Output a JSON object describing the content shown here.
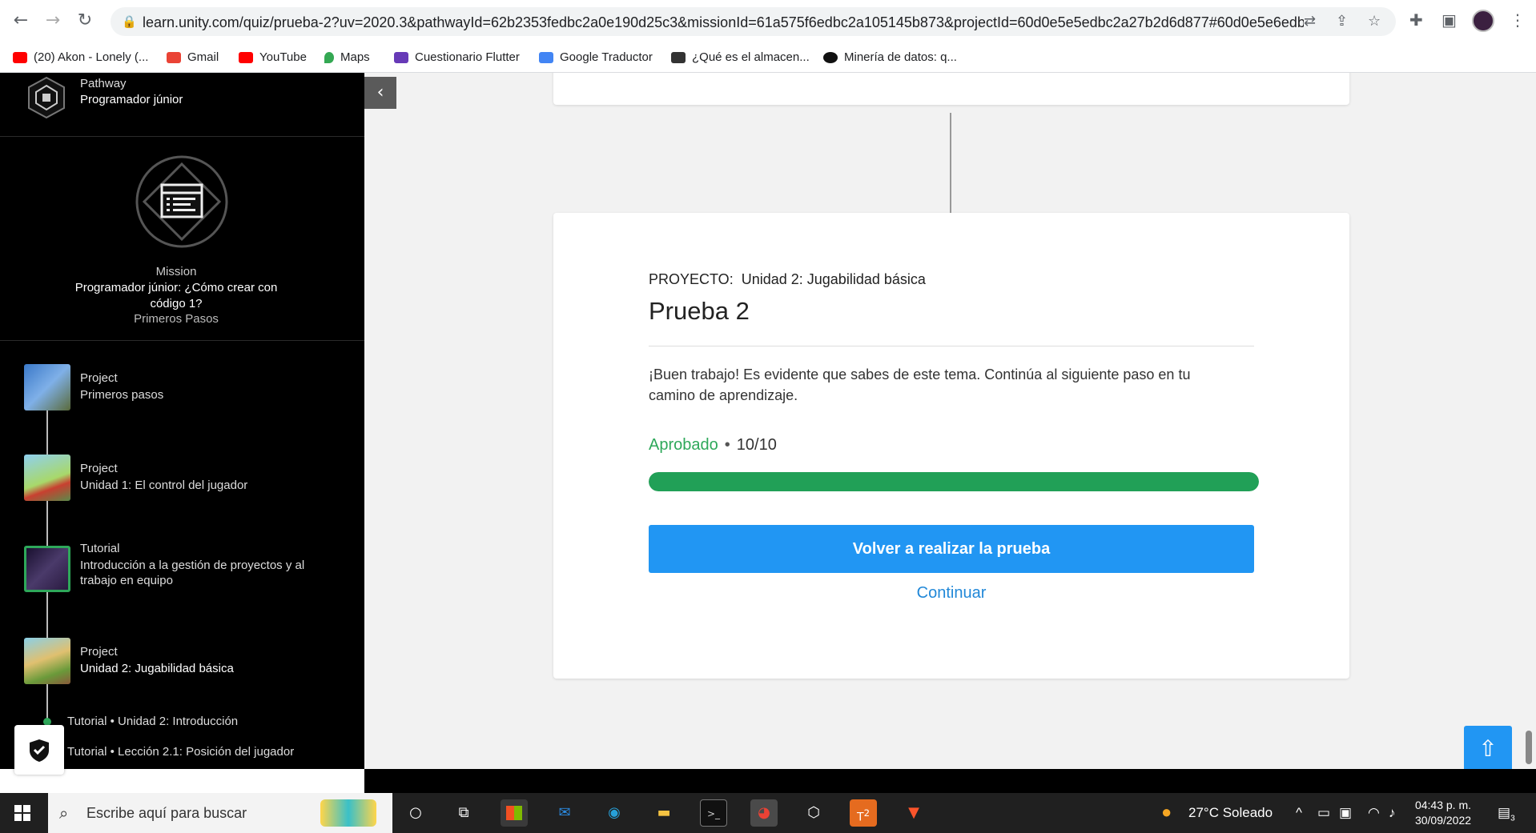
{
  "browser": {
    "url": "learn.unity.com/quiz/prueba-2?uv=2020.3&pathwayId=62b2353fedbc2a0e190d25c3&missionId=61a575f6edbc2a105145b873&projectId=60d0e5e5edbc2a27b2d6d877#60d0e5e6edbc...",
    "bookmarks": [
      {
        "label": "(20) Akon - Lonely (...",
        "icon": "youtube-icon",
        "color": "#ff0000"
      },
      {
        "label": "Gmail",
        "icon": "gmail-icon",
        "color": "#ea4335"
      },
      {
        "label": "YouTube",
        "icon": "youtube-icon",
        "color": "#ff0000"
      },
      {
        "label": "Maps",
        "icon": "maps-icon",
        "color": "#34a853"
      },
      {
        "label": "Cuestionario Flutter",
        "icon": "forms-icon",
        "color": "#673ab7"
      },
      {
        "label": "Google Traductor",
        "icon": "translate-icon",
        "color": "#4285f4"
      },
      {
        "label": "¿Qué es el almacen...",
        "icon": "site-icon",
        "color": "#333333"
      },
      {
        "label": "Minería de datos: q...",
        "icon": "site-icon",
        "color": "#111111"
      }
    ]
  },
  "sidebar": {
    "pathway_label": "Pathway",
    "pathway_name": "Programador júnior",
    "mission_label": "Mission",
    "mission_title": "Programador júnior: ¿Cómo crear con código 1?",
    "mission_subtitle": "Primeros Pasos",
    "projects": [
      {
        "type": "Project",
        "name": "Primeros pasos"
      },
      {
        "type": "Project",
        "name": "Unidad 1: El control del jugador"
      },
      {
        "type": "Tutorial",
        "name": "Introducción a la gestión de proyectos y al trabajo en equipo"
      },
      {
        "type": "Project",
        "name": "Unidad 2: Jugabilidad básica"
      }
    ],
    "sub_items": [
      "Tutorial • Unidad 2: Introducción",
      "Tutorial • Lección 2.1: Posición del jugador"
    ]
  },
  "quiz": {
    "project_prefix": "PROYECTO:",
    "project_name": "Unidad 2: Jugabilidad básica",
    "title": "Prueba 2",
    "feedback": "¡Buen trabajo! Es evidente que sabes de este tema. Continúa al siguiente paso en tu camino de aprendizaje.",
    "status": "Aprobado",
    "separator": "•",
    "score": "10/10",
    "progress": 1.0,
    "retake_label": "Volver a realizar la prueba",
    "continue_label": "Continuar"
  },
  "taskbar": {
    "search_placeholder": "Escribe aquí para buscar",
    "weather": "27°C  Soleado",
    "time": "04:43 p. m.",
    "date": "30/09/2022",
    "notifications": "3",
    "teams_badge": "2"
  },
  "colors": {
    "accent_blue": "#2196f3",
    "success_green": "#21a057"
  }
}
